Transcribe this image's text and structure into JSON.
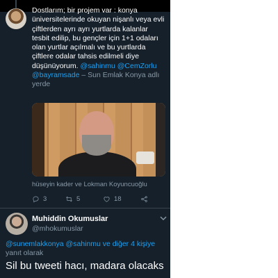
{
  "tweet1": {
    "text_lines": [
      "Dostlarım; bir projem var : konya",
      "üniversitelerinde okuyan nişanlı veya evli",
      "çiftlerden ayrı ayrı yurtlarda kalanlar",
      "tesbit edilip, bu gençler için  1+1 odaları",
      "olan yurtlar açılmalı ve bu yurtlarda",
      "çiftlere odalar tahsis edilmeli diye"
    ],
    "last_line_text": "düşünüyorum.",
    "mentions": [
      "@sahinmu",
      "@CemZorlu",
      "@bayramsade"
    ],
    "location_prefix": " – ",
    "location": "Sun Emlak Konya adlı yerde",
    "tagged_people": "hüseyin kader ve Lokman Koyuncuoğlu",
    "reply_count": "3",
    "retweet_count": "5",
    "like_count": "18"
  },
  "reply": {
    "display_name": "Muhiddin Okumuslar",
    "handle": "@mhokumuslar",
    "replying_to_link": "@sunemlakkonya @sahinmu ve diğer 4 kişiye",
    "replying_to_suffix": "yanıt olarak",
    "text": "Sil bu tweeti hacı, madara olacaks"
  },
  "icons": [
    "reply-icon",
    "retweet-icon",
    "like-icon",
    "share-icon",
    "chevron-down-icon"
  ],
  "colors": {
    "background": "#15202b",
    "link": "#1da1f2",
    "secondary_text": "#8899a6",
    "divider": "#38444d"
  }
}
